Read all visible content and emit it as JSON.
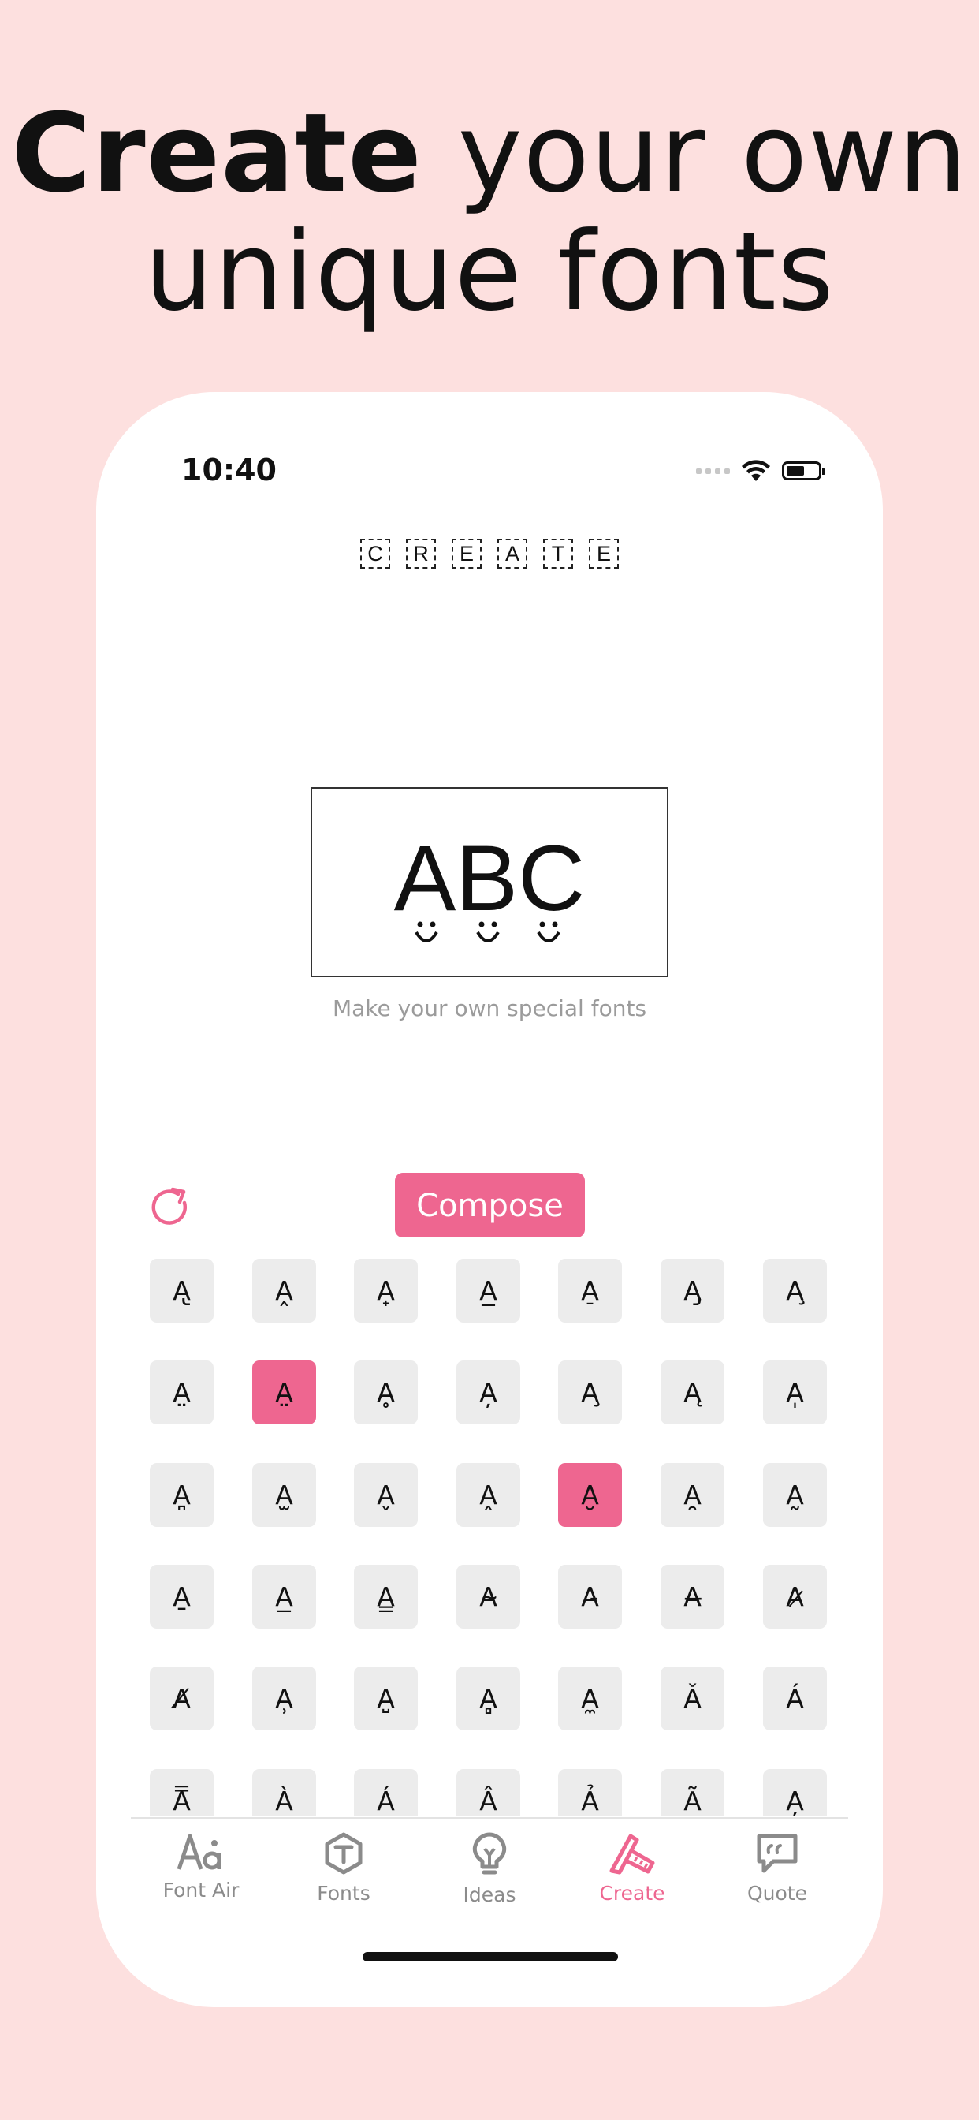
{
  "headline": {
    "bold": "Create",
    "rest": " your own",
    "line2": "unique fonts"
  },
  "status": {
    "time": "10:40"
  },
  "app": {
    "title_letters": [
      "C",
      "R",
      "E",
      "A",
      "T",
      "E"
    ],
    "preview_text": "ABC",
    "caption": "Make your own special fonts",
    "compose_label": "Compose"
  },
  "grid": {
    "rows": [
      [
        "A̢",
        "A̭",
        "A̟",
        "A̲",
        "A̠",
        "A̡",
        "A̧"
      ],
      [
        "A̤",
        "A̤",
        "Ḁ",
        "A̦",
        "A̧",
        "Ą",
        "A̩"
      ],
      [
        "A̪",
        "A̫",
        "A̬",
        "A̭",
        "A̮",
        "A̯",
        "A̰"
      ],
      [
        "A̱",
        "A̲",
        "A̳",
        "A̴",
        "A̵",
        "A̶",
        "A̷"
      ],
      [
        "A̸",
        "A̹",
        "A̺",
        "A̻",
        "A̼",
        "Ǎ",
        "Á"
      ],
      [
        "A̿",
        "À",
        "Á",
        "Â",
        "Ả",
        "Ã",
        "A̦"
      ]
    ],
    "selected": [
      [
        1,
        1
      ],
      [
        2,
        4
      ]
    ]
  },
  "tabs": [
    {
      "label": "Font Air",
      "icon": "font-air-icon"
    },
    {
      "label": "Fonts",
      "icon": "fonts-hexagon-icon"
    },
    {
      "label": "Ideas",
      "icon": "lightbulb-icon"
    },
    {
      "label": "Create",
      "icon": "pencil-ruler-icon",
      "active": true
    },
    {
      "label": "Quote",
      "icon": "quote-bubble-icon"
    }
  ],
  "colors": {
    "accent": "#ee6690",
    "background": "#fde0df",
    "cell": "#ececec"
  }
}
